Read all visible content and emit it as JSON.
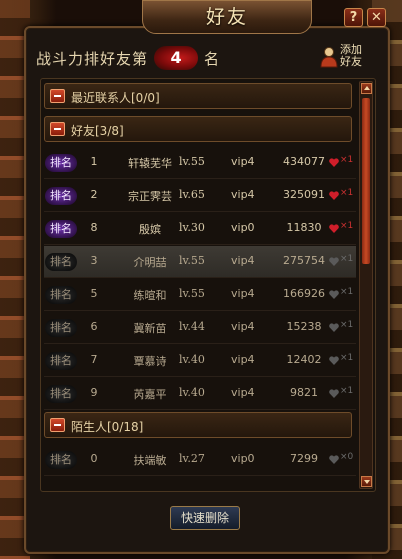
{
  "window": {
    "title": "好友",
    "help_label": "?",
    "close_label": "✕"
  },
  "rank_strip": {
    "prefix": "战斗力排好友第",
    "rank": "4",
    "suffix": "名"
  },
  "add_friend": {
    "label": "添加好友",
    "icon": "person-add-icon"
  },
  "sections": {
    "recent": "最近联系人[0/0]",
    "friends": "好友[3/8]",
    "strangers": "陌生人[0/18]"
  },
  "badge_label": "排名",
  "friends": [
    {
      "rank": "1",
      "name": "轩辕芜华",
      "level": "lv.55",
      "vip": "vip4",
      "power": "434077",
      "hearts": "×1",
      "active": true
    },
    {
      "rank": "2",
      "name": "宗正霁芸",
      "level": "lv.65",
      "vip": "vip4",
      "power": "325091",
      "hearts": "×1",
      "active": true
    },
    {
      "rank": "8",
      "name": "殷嫔",
      "level": "lv.30",
      "vip": "vip0",
      "power": "11830",
      "hearts": "×1",
      "active": true
    },
    {
      "rank": "3",
      "name": "介明喆",
      "level": "lv.55",
      "vip": "vip4",
      "power": "275754",
      "hearts": "×1",
      "active": false
    },
    {
      "rank": "5",
      "name": "练暄和",
      "level": "lv.55",
      "vip": "vip4",
      "power": "166926",
      "hearts": "×1",
      "active": false
    },
    {
      "rank": "6",
      "name": "冀新苗",
      "level": "lv.44",
      "vip": "vip4",
      "power": "15238",
      "hearts": "×1",
      "active": false
    },
    {
      "rank": "7",
      "name": "覃慕诗",
      "level": "lv.40",
      "vip": "vip4",
      "power": "12402",
      "hearts": "×1",
      "active": false
    },
    {
      "rank": "9",
      "name": "芮嘉平",
      "level": "lv.40",
      "vip": "vip4",
      "power": "9821",
      "hearts": "×1",
      "active": false
    }
  ],
  "strangers": [
    {
      "rank": "0",
      "name": "扶端敏",
      "level": "lv.27",
      "vip": "vip0",
      "power": "7299",
      "hearts": "×0",
      "active": false
    }
  ],
  "buttons": {
    "quick_delete": "快速删除"
  },
  "colors": {
    "accent_red": "#c41a1a",
    "vip_purple": "#6a30a8",
    "frame": "#6b4a2a"
  }
}
